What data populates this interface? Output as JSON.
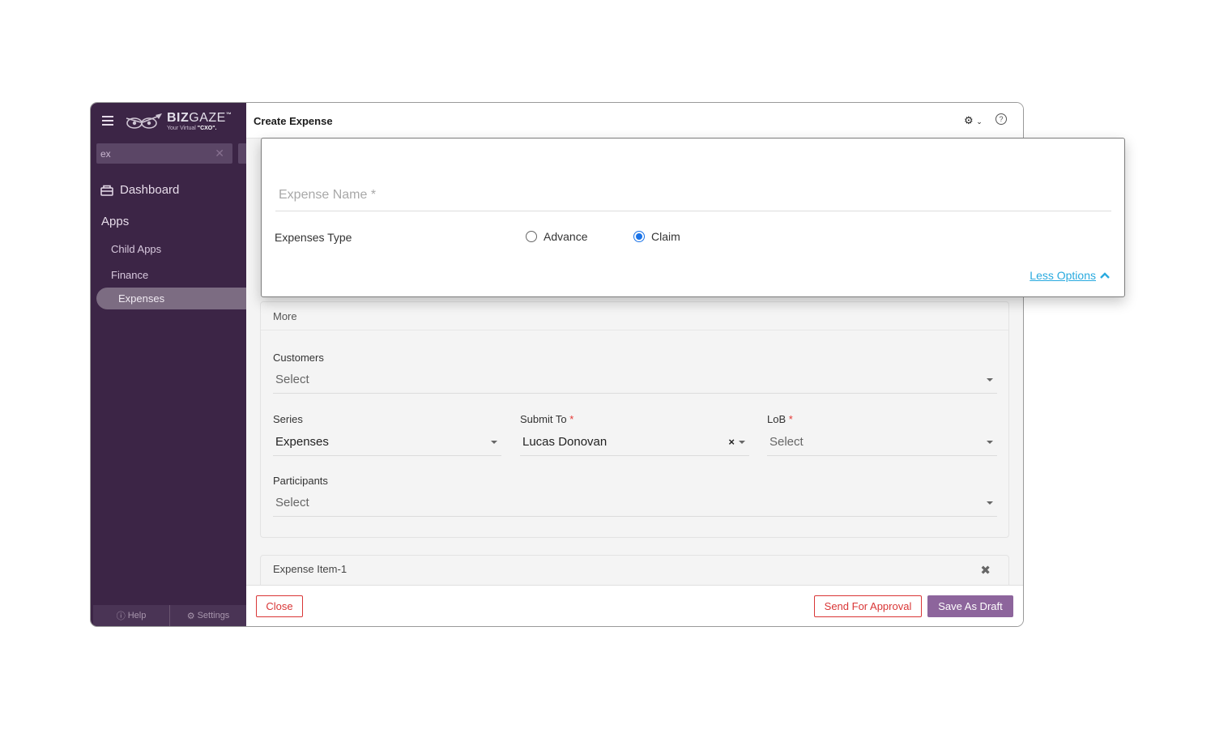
{
  "sidebar": {
    "logo": {
      "brand_bold": "BIZ",
      "brand_thin": "GAZE",
      "tm": "™",
      "tagline_prefix": "Your Virtual ",
      "tagline_bold": "\"CXO\"."
    },
    "search": {
      "value": "ex"
    },
    "dashboard_label": "Dashboard",
    "apps_label": "Apps",
    "items": [
      {
        "label": "Child Apps"
      },
      {
        "label": "Finance"
      },
      {
        "label": "Expenses",
        "active": true
      }
    ],
    "footer": {
      "help_label": "Help",
      "settings_label": "Settings"
    }
  },
  "main": {
    "title": "Create Expense",
    "more_section": {
      "heading": "More",
      "customers": {
        "label": "Customers",
        "placeholder": "Select"
      },
      "series": {
        "label": "Series",
        "value": "Expenses"
      },
      "submit_to": {
        "label": "Submit To",
        "required": "*",
        "value": "Lucas Donovan"
      },
      "lob": {
        "label": "LoB",
        "required": "*",
        "placeholder": "Select"
      },
      "participants": {
        "label": "Participants",
        "placeholder": "Select"
      }
    },
    "expense_item": {
      "title": "Expense Item-1"
    },
    "footer": {
      "close_label": "Close",
      "approve_label": "Send For Approval",
      "draft_label": "Save As Draft"
    }
  },
  "popup": {
    "name_placeholder": "Expense Name *",
    "type_label": "Expenses Type",
    "options": [
      {
        "label": "Advance",
        "selected": false
      },
      {
        "label": "Claim",
        "selected": true
      }
    ],
    "less_options_label": "Less Options"
  },
  "colors": {
    "sidebar_bg": "#3c2546",
    "accent_purple": "#8d659c",
    "danger_red": "#d93636",
    "link_blue": "#29aadf",
    "radio_blue": "#1a73e8"
  },
  "icons": [
    "menu-icon",
    "owl-logo-icon",
    "close-icon",
    "dashboard-icon",
    "help-icon",
    "settings-gear-icon",
    "chevron-down-icon",
    "dropdown-caret-icon",
    "chevron-up-icon"
  ]
}
